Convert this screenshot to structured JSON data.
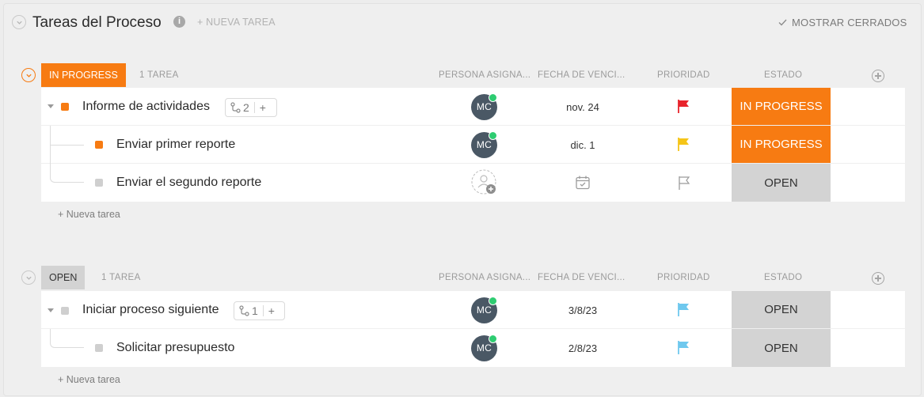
{
  "header": {
    "title": "Tareas del Proceso",
    "info_icon": "i",
    "new_task": "+ NUEVA TAREA",
    "show_closed": "MOSTRAR CERRADOS"
  },
  "columns": {
    "assignee": "PERSONA ASIGNA...",
    "due_date": "FECHA DE VENCI...",
    "priority": "PRIORIDAD",
    "status": "ESTADO"
  },
  "colors": {
    "in_progress": "#f77b12",
    "open": "#d3d3d3",
    "flag_urgent": "#e8232b",
    "flag_high": "#f5c518",
    "flag_normal": "#6fc8ee",
    "avatar": "#4a5865",
    "online": "#2ecc71"
  },
  "groups": [
    {
      "badge": "IN PROGRESS",
      "count": "1 TAREA",
      "new_task_link": "+ Nueva tarea",
      "tasks": [
        {
          "name": "Informe de actividades",
          "subtask_count": "2",
          "add_icon": "+",
          "assignee": "MC",
          "due": "nov. 24",
          "priority_icon": "flag-red-icon",
          "status": "IN PROGRESS"
        },
        {
          "name": "Enviar primer reporte",
          "assignee": "MC",
          "due": "dic. 1",
          "priority_icon": "flag-yellow-icon",
          "status": "IN PROGRESS"
        },
        {
          "name": "Enviar el segundo reporte",
          "assignee_icon": "add-assignee-icon",
          "due_icon": "calendar-icon",
          "priority_icon": "flag-outline-icon",
          "status": "OPEN"
        }
      ]
    },
    {
      "badge": "OPEN",
      "count": "1 TAREA",
      "new_task_link": "+ Nueva tarea",
      "tasks": [
        {
          "name": "Iniciar proceso siguiente",
          "subtask_count": "1",
          "add_icon": "+",
          "assignee": "MC",
          "due": "3/8/23",
          "priority_icon": "flag-blue-icon",
          "status": "OPEN"
        },
        {
          "name": "Solicitar presupuesto",
          "assignee": "MC",
          "due": "2/8/23",
          "priority_icon": "flag-blue-icon",
          "status": "OPEN"
        }
      ]
    }
  ]
}
